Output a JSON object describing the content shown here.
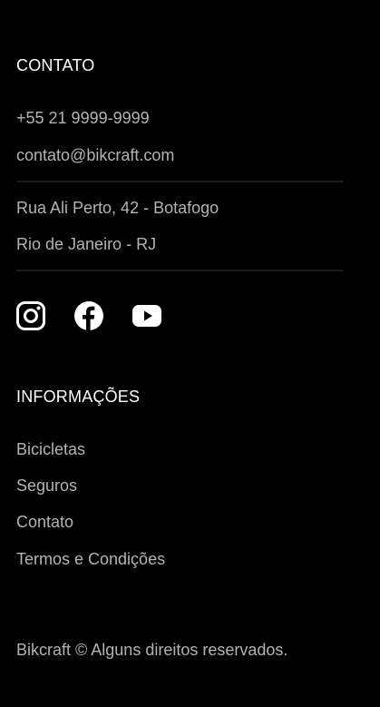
{
  "contact": {
    "heading": "CONTATO",
    "phone": "+55 21 9999-9999",
    "email": "contato@bikcraft.com",
    "address_line1": "Rua Ali Perto, 42 - Botafogo",
    "address_line2": "Rio de Janeiro - RJ"
  },
  "social": {
    "icons": [
      "instagram-icon",
      "facebook-icon",
      "youtube-icon"
    ]
  },
  "info": {
    "heading": "INFORMAÇÕES",
    "links": [
      "Bicicletas",
      "Seguros",
      "Contato",
      "Termos e Condições"
    ]
  },
  "copyright": "Bikcraft © Alguns direitos reservados.",
  "colors": {
    "background": "#000000",
    "heading": "#ffffff",
    "text": "#b3b3b3",
    "divider": "#1c1c1c"
  }
}
